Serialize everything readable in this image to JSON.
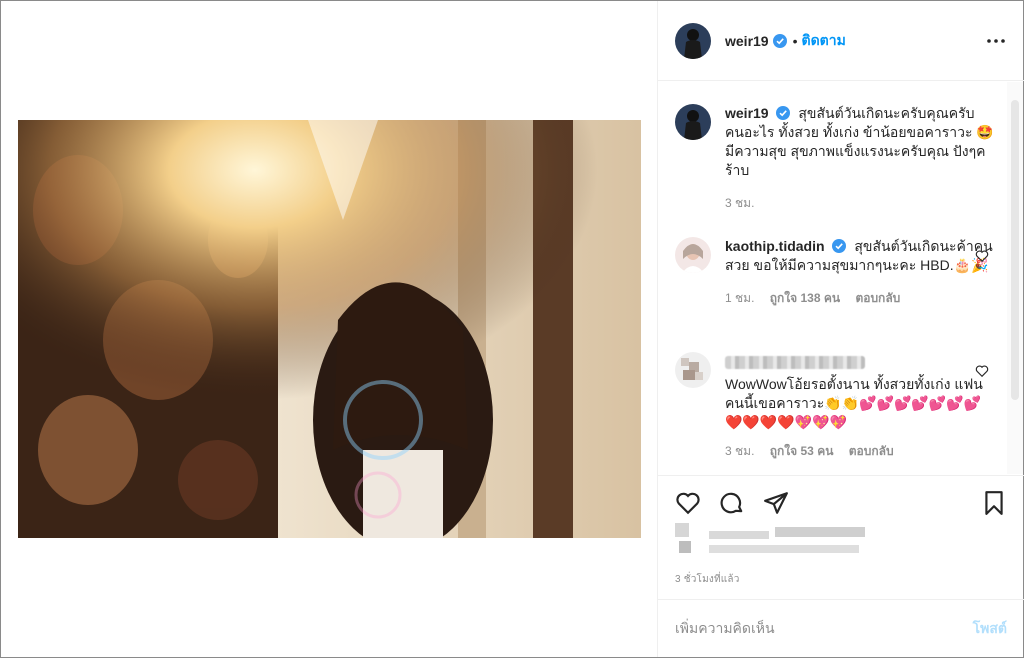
{
  "header": {
    "username": "weir19",
    "separator": "•",
    "follow_label": "ติดตาม"
  },
  "caption": {
    "username": "weir19",
    "text": "สุขสันต์วันเกิดนะครับคุณครับ คนอะไร ทั้งสวย ทั้งเก่ง ข้าน้อยขอคาราวะ 🤩 มีความสุข สุขภาพแข็งแรงนะครับคุณ ปังๆคร้าบ",
    "time": "3 ชม."
  },
  "comments": [
    {
      "username": "kaothip.tidadin",
      "text": "สุขสันต์วันเกิดนะค้าคนสวย ขอให้มีความสุขมากๆนะคะ HBD.🎂🎉",
      "time": "1 ชม.",
      "likes": "ถูกใจ 138 คน",
      "reply": "ตอบกลับ"
    },
    {
      "username": "",
      "text": "WowWowโอ้ยรอตั้งนาน ทั้งสวยทั้งเก่ง แฟนคนนี้เขอคาราวะ👏👏💕💕💕💕💕💕💕❤️❤️❤️❤️💖💖💖",
      "time": "3 ชม.",
      "likes": "ถูกใจ 53 คน",
      "reply": "ตอบกลับ"
    }
  ],
  "post": {
    "timestamp": "3 ชั่วโมงที่แล้ว"
  },
  "add_comment": {
    "placeholder": "เพิ่มความคิดเห็น",
    "post_label": "โพสต์"
  },
  "colors": {
    "accent": "#0095f6",
    "verified": "#3897f0",
    "post_disabled": "#b2dffc",
    "muted": "#8e8e8e"
  },
  "icons": [
    "more-icon",
    "verified-icon",
    "heart-icon",
    "comment-icon",
    "share-icon",
    "bookmark-icon"
  ]
}
